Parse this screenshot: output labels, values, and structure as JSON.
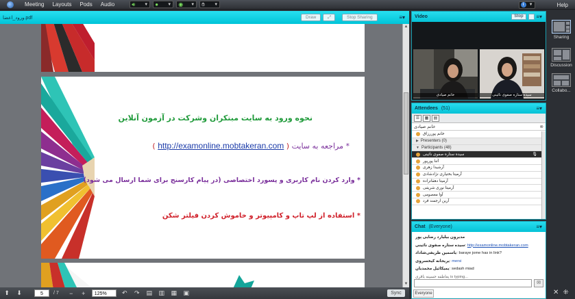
{
  "menubar": {
    "items": [
      "Meeting",
      "Layouts",
      "Pods",
      "Audio"
    ],
    "help": "Help"
  },
  "share": {
    "filename": "ورود_اعضا.pdf",
    "draw": "Draw",
    "stop_sharing": "Stop Sharing"
  },
  "slide": {
    "title": "نحوه ورود به سایت مبتکران وشرکت در آزمون آنلاین",
    "step1_prefix": "* مراجعه به سایت",
    "step1_link": "http://examonline.mobtakeran.com",
    "step2": "* وارد کردن نام کاربری و پسورد اختصاصی (در پیام کارسنج برای شما ارسال می شود)",
    "step3": "* استفاده از لپ تاپ و کامپیوتر  و خاموش کردن فیلتر شکن"
  },
  "toolbar": {
    "page": "5",
    "total": "/ 7",
    "zoom": "125%",
    "sync": "Sync"
  },
  "video": {
    "title": "Video",
    "stop": "Stop",
    "name_left": "خانم صیادی",
    "name_right": "سیده ستاره صفوی نائینی"
  },
  "attendees": {
    "title": "Attendees",
    "count": "(51)",
    "host_row": "خانم صیادی",
    "host_sub": "خانم پوررزاق",
    "presenters": "Presenters (0)",
    "participants": "Participants (48)",
    "list": [
      "سیده ستاره صفوی نائینی",
      "آتنا پورپور",
      "آرشیدا زهری",
      "آرمیتا بختیاری نژادشادی",
      "آرمیتا دهقانزاده",
      "آرمیتا نوری شریفی",
      "آوا معصومی",
      "آرین ارجمند فرد"
    ]
  },
  "chat": {
    "title": "Chat",
    "scope": "(Everyone)",
    "lines": [
      {
        "who": "مدیرون بیلیارد رضایی پور",
        "msg": ""
      },
      {
        "who": "سیده ستاره صفوی نائینی",
        "msg": "http://examonline.mobtakeran.com",
        "type": "link"
      },
      {
        "who": "یاسمین ظریفی‌شاداد",
        "msg": "baraye jome has in link?"
      },
      {
        "who": "یریحانه کیخسروی",
        "msg": "mersi",
        "type": "blue"
      },
      {
        "who": "یمیکائیل محمدیان",
        "msg": "sedash miad"
      },
      {
        "who": "یعاطفه حسینه باقری",
        "msg": "is typing..."
      }
    ],
    "tab": "Everyone"
  },
  "rail": {
    "layouts": [
      "Sharing",
      "Discussion",
      "Collabo..."
    ]
  }
}
